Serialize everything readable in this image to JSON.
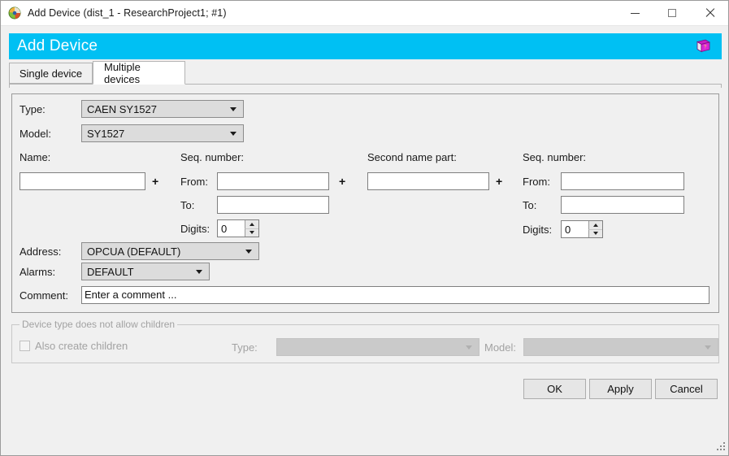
{
  "window": {
    "title": "Add Device (dist_1 - ResearchProject1; #1)",
    "app_icon": "winccoa-globe-icon",
    "minimize_label": "—",
    "maximize_label": "□",
    "close_label": "✕"
  },
  "banner": {
    "title": "Add Device",
    "accent_color": "#00c0f3",
    "help_icon": "help-book-icon"
  },
  "tabs": [
    {
      "label": "Single device",
      "active": false
    },
    {
      "label": "Multiple devices",
      "active": true
    }
  ],
  "form": {
    "type": {
      "label": "Type:",
      "value": "CAEN SY1527"
    },
    "model": {
      "label": "Model:",
      "value": "SY1527"
    },
    "name": {
      "label": "Name:",
      "value": ""
    },
    "seq_number_1": {
      "label": "Seq. number:",
      "from_label": "From:",
      "from_value": "",
      "to_label": "To:",
      "to_value": "",
      "digits_label": "Digits:",
      "digits_value": "0"
    },
    "second_name_part": {
      "label": "Second name part:",
      "value": ""
    },
    "seq_number_2": {
      "label": "Seq. number:",
      "from_label": "From:",
      "from_value": "",
      "to_label": "To:",
      "to_value": "",
      "digits_label": "Digits:",
      "digits_value": "0"
    },
    "plus_1": "+",
    "plus_2": "+",
    "plus_3": "+",
    "address": {
      "label": "Address:",
      "value": "OPCUA (DEFAULT)"
    },
    "alarms": {
      "label": "Alarms:",
      "value": "DEFAULT"
    },
    "comment": {
      "label": "Comment:",
      "value": "Enter a comment ..."
    }
  },
  "children_group": {
    "title": "Device type does not allow children",
    "checkbox_label": "Also create children",
    "checkbox_checked": false,
    "type_label": "Type:",
    "type_value": "",
    "model_label": "Model:",
    "model_value": ""
  },
  "buttons": {
    "ok": "OK",
    "apply": "Apply",
    "cancel": "Cancel"
  },
  "statusbar": {
    "resize_grip": "resize-grip"
  }
}
